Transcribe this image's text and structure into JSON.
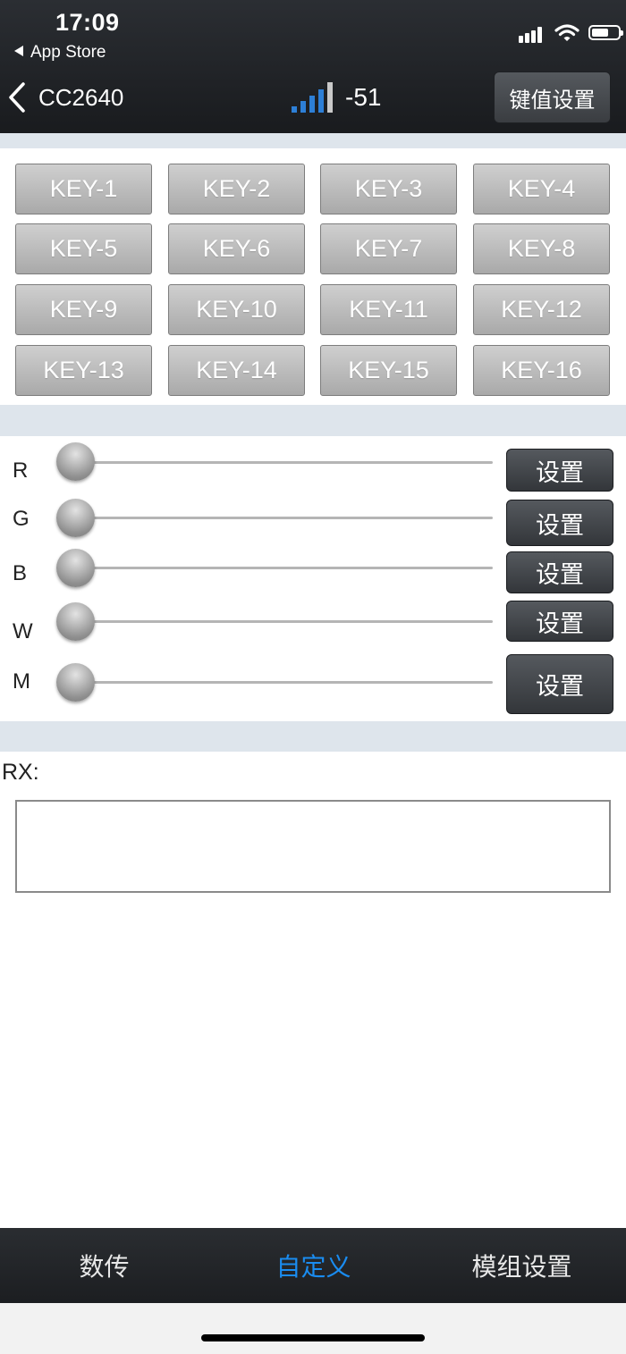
{
  "status_bar": {
    "time": "17:09",
    "back_app": "App Store"
  },
  "nav": {
    "title": "CC2640",
    "rssi": "-51",
    "keyset_label": "键值设置"
  },
  "keys": [
    "KEY-1",
    "KEY-2",
    "KEY-3",
    "KEY-4",
    "KEY-5",
    "KEY-6",
    "KEY-7",
    "KEY-8",
    "KEY-9",
    "KEY-10",
    "KEY-11",
    "KEY-12",
    "KEY-13",
    "KEY-14",
    "KEY-15",
    "KEY-16"
  ],
  "sliders": [
    {
      "label": "R",
      "value": 0,
      "button": "设置"
    },
    {
      "label": "G",
      "value": 0,
      "button": "设置"
    },
    {
      "label": "B",
      "value": 0,
      "button": "设置"
    },
    {
      "label": "W",
      "value": 0,
      "button": "设置"
    },
    {
      "label": "M",
      "value": 0,
      "button": "设置"
    }
  ],
  "rx": {
    "label": "RX:",
    "value": ""
  },
  "tabs": [
    {
      "label": "数传",
      "active": false
    },
    {
      "label": "自定义",
      "active": true
    },
    {
      "label": "模组设置",
      "active": false
    }
  ],
  "colors": {
    "accent": "#1a8cf0",
    "signal_blue": "#2d7fd6",
    "signal_gray": "#c9c9c9"
  }
}
